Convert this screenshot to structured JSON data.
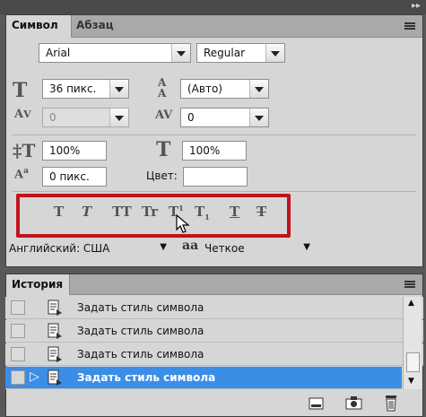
{
  "character_panel": {
    "tabs": [
      {
        "label": "Символ",
        "active": true
      },
      {
        "label": "Абзац",
        "active": false
      }
    ],
    "font_family": "Arial",
    "font_style": "Regular",
    "font_size": "36 пикс.",
    "leading": "(Авто)",
    "kerning": "0",
    "tracking": "0",
    "vertical_scale": "100%",
    "horizontal_scale": "100%",
    "baseline_shift": "0 пикс.",
    "color_label": "Цвет:",
    "style_buttons": [
      "T",
      "T",
      "TT",
      "Tr",
      "T",
      "T",
      "T",
      "T"
    ],
    "language": "Английский: США",
    "antialias_icon": "aa",
    "antialias": "Четкое"
  },
  "history_panel": {
    "tab": "История",
    "items": [
      {
        "label": "Задать стиль символа",
        "selected": false
      },
      {
        "label": "Задать стиль символа",
        "selected": false
      },
      {
        "label": "Задать стиль символа",
        "selected": false
      },
      {
        "label": "Задать стиль символа",
        "selected": true
      }
    ]
  },
  "colors": {
    "highlight_box": "#c0141c",
    "selected_row": "#3a8ee6"
  }
}
